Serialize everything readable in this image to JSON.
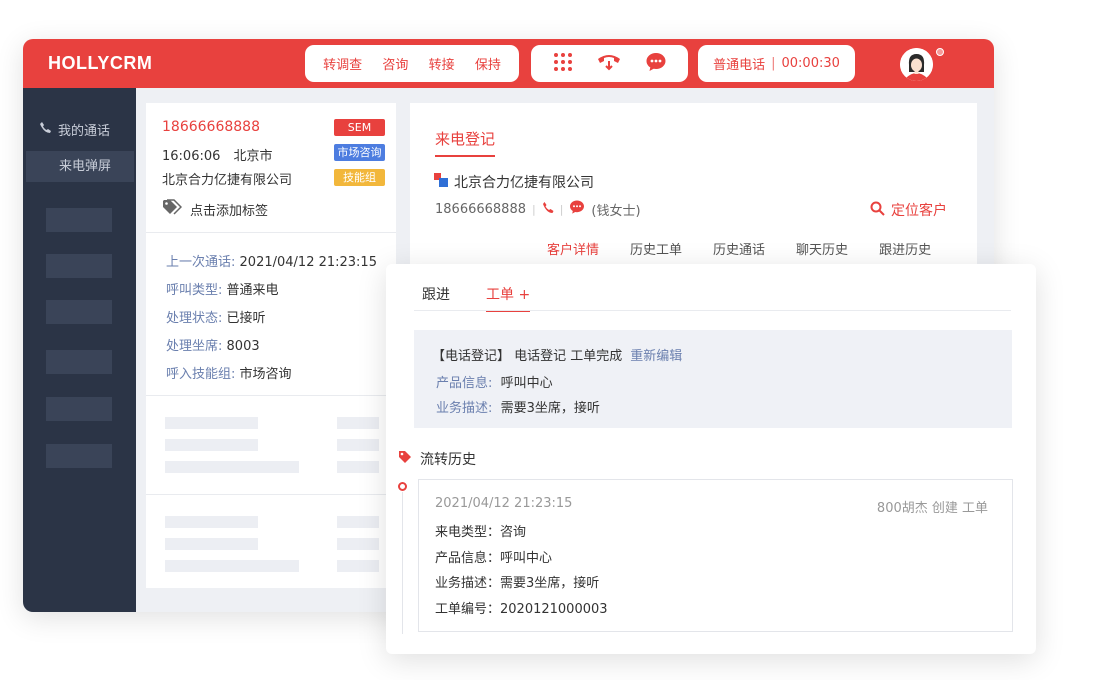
{
  "brand": "HOLLYCRM",
  "call_actions": [
    "转调查",
    "咨询",
    "转接",
    "保持"
  ],
  "call_status": {
    "type": "普通电话",
    "timer": "00:00:30"
  },
  "sidebar": {
    "nav_label": "我的通话",
    "sub_item": "来电弹屏"
  },
  "caller": {
    "phone": "18666668888",
    "time": "16:06:06",
    "city": "北京市",
    "company": "北京合力亿捷有限公司",
    "tags": [
      {
        "label": "SEM",
        "color": "#e8413e"
      },
      {
        "label": "市场咨询",
        "color": "#4d7de0"
      },
      {
        "label": "技能组",
        "color": "#f2b73b"
      }
    ],
    "add_tag_label": "点击添加标签",
    "details": [
      {
        "key": "上一次通话:",
        "value": "2021/04/12 21:23:15"
      },
      {
        "key": "呼叫类型:",
        "value": "普通来电"
      },
      {
        "key": "处理状态:",
        "value": "已接听"
      },
      {
        "key": "处理坐席:",
        "value": "8003"
      },
      {
        "key": "呼入技能组:",
        "value": "市场咨询"
      }
    ]
  },
  "customer": {
    "section_title": "来电登记",
    "company": "北京合力亿捷有限公司",
    "phone": "18666668888",
    "contact_name": "(钱女士)",
    "locate_label": "定位客户",
    "tabs": [
      "客户详情",
      "历史工单",
      "历史通话",
      "聊天历史",
      "跟进历史"
    ]
  },
  "work_order": {
    "tabs": [
      "跟进",
      "工单 +"
    ],
    "ticket": {
      "title": "【电话登记】 电话登记 工单完成",
      "edit_link": "重新编辑",
      "product_key": "产品信息:",
      "product_value": "呼叫中心",
      "desc_key": "业务描述:",
      "desc_value": "需要3坐席，接听"
    },
    "history_title": "流转历史",
    "history": {
      "time": "2021/04/12 21:23:15",
      "meta": "800胡杰 创建 工单",
      "lines": [
        "来电类型：咨询",
        "产品信息：呼叫中心",
        "业务描述：需要3坐席，接听",
        "工单编号：2020121000003"
      ]
    }
  },
  "colors": {
    "accent": "#e8413e",
    "sidebar": "#2b3446",
    "label": "#6a7fae"
  }
}
